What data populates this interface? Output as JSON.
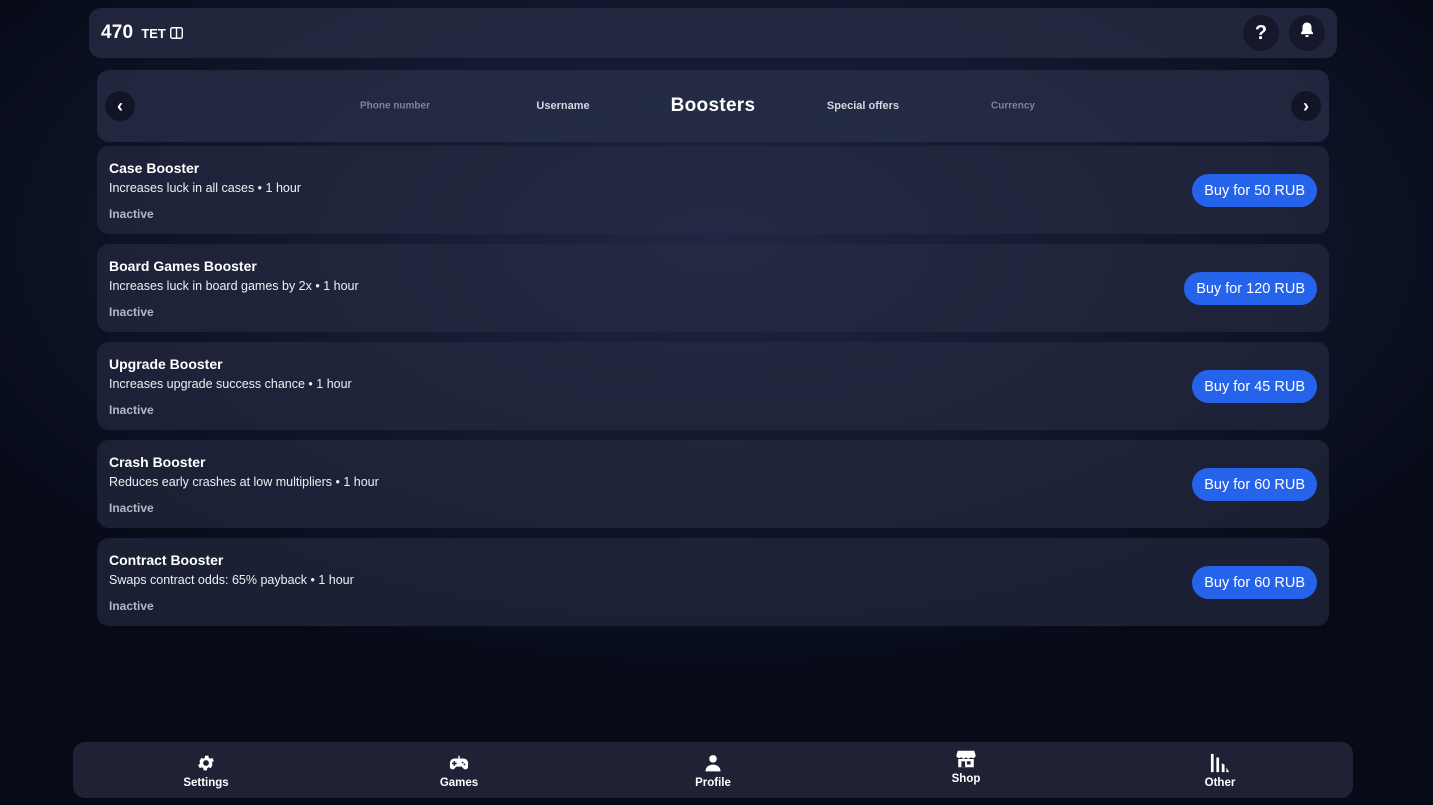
{
  "header": {
    "balance": "470",
    "currency": "TET",
    "currency_icon": "book-icon",
    "help_label": "?",
    "notifications_icon": "bell-icon"
  },
  "tabs": {
    "prev_label": "‹",
    "next_label": "›",
    "items": [
      {
        "label": "Phone number",
        "state": "far"
      },
      {
        "label": "Username",
        "state": "near"
      },
      {
        "label": "Boosters",
        "state": "active"
      },
      {
        "label": "Special offers",
        "state": "near"
      },
      {
        "label": "Currency",
        "state": "far"
      }
    ]
  },
  "boosters": [
    {
      "title": "Case Booster",
      "description": "Increases luck in all cases • 1 hour",
      "status": "Inactive",
      "button": "Buy for 50 RUB"
    },
    {
      "title": "Board Games Booster",
      "description": "Increases luck in board games by 2x • 1 hour",
      "status": "Inactive",
      "button": "Buy for 120 RUB"
    },
    {
      "title": "Upgrade Booster",
      "description": "Increases upgrade success chance • 1 hour",
      "status": "Inactive",
      "button": "Buy for 45 RUB"
    },
    {
      "title": "Crash Booster",
      "description": "Reduces early crashes at low multipliers • 1 hour",
      "status": "Inactive",
      "button": "Buy for 60 RUB"
    },
    {
      "title": "Contract Booster",
      "description": "Swaps contract odds: 65% payback • 1 hour",
      "status": "Inactive",
      "button": "Buy for 60 RUB"
    }
  ],
  "bottom_nav": [
    {
      "label": "Settings",
      "icon": "gear-icon"
    },
    {
      "label": "Games",
      "icon": "gamepad-icon"
    },
    {
      "label": "Profile",
      "icon": "user-icon"
    },
    {
      "label": "Shop",
      "icon": "store-icon"
    },
    {
      "label": "Other",
      "icon": "chart-icon"
    }
  ],
  "colors": {
    "accent": "#2563eb",
    "card_bg": "#262b42",
    "nav_bg": "#1e2234"
  }
}
